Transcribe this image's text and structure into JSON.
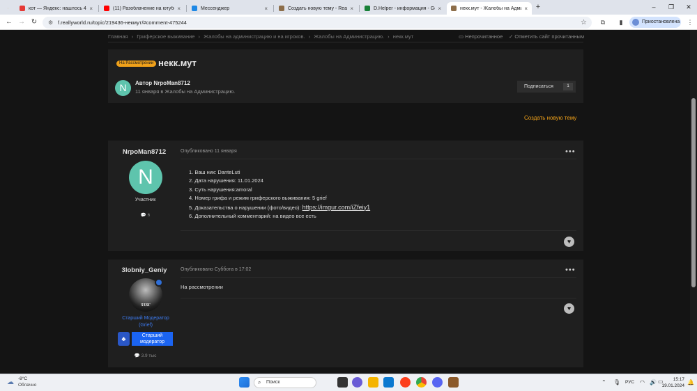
{
  "browser": {
    "tabs": [
      {
        "title": "кот — Яндекс: нашлось 4 тыс. р",
        "favicon_color": "#e53935",
        "active": false
      },
      {
        "title": "(11) Разоблачение на ютубер",
        "favicon_color": "#ff0000",
        "active": false
      },
      {
        "title": "Мессенджер",
        "favicon_color": "#1e88e5",
        "active": false
      },
      {
        "title": "Создать новую тему - ReallyW",
        "favicon_color": "#8d6e4a",
        "active": false
      },
      {
        "title": "D.Helper - информация - Goog",
        "favicon_color": "#188038",
        "active": false
      },
      {
        "title": "некк.мут - Жалобы на Админ",
        "favicon_color": "#8d6e4a",
        "active": true
      }
    ],
    "tab_close": "×",
    "new_tab": "+",
    "window_controls": {
      "minimize": "–",
      "maximize": "❐",
      "close": "✕"
    },
    "nav": {
      "back": "←",
      "forward": "→",
      "reload": "↻"
    },
    "url": "f.reallyworld.ru/topic/219436-некмут/#comment-475244",
    "profile_label": "Приостановлена"
  },
  "forum": {
    "breadcrumb": [
      "Главная",
      "›",
      "Гриферское выживание",
      "›",
      "Жалобы на администрацию и на игроков.",
      "›",
      "Жалобы на Администрацию.",
      "›",
      "некк.мут"
    ],
    "unread_label": "Непрочитанное",
    "mark_read_label": "Отметить сайт прочитанным",
    "topic": {
      "status": "На Рассмотрении",
      "title": "некк.мут",
      "author_line": "Автор NrpoMan8712",
      "meta": "11 января в Жалобы на Администрацию.",
      "avatar_letter": "N",
      "subscribe_label": "Подписаться",
      "subscribe_count": "1"
    },
    "new_topic_label": "Создать новую тему",
    "posts": [
      {
        "author": "NrpoMan8712",
        "avatar_letter": "N",
        "role": "Участник",
        "post_count": "6",
        "date": "Опубликовано 11 января",
        "menu": "•••",
        "like": "♥",
        "body": [
          "1. Ваш ник: DanteLuti",
          "2. Дата нарушения: 11.01.2024",
          "3. Суть нарушения:amoral",
          "4. Номер грифа и режим гриферского выживания: 5 grief"
        ],
        "evidence_label": "5. Доказательства о нарушении (фото/видео): ",
        "evidence_link": "https://imgur.com/iZfeiy1",
        "comment": "6. Дополнительный комментарий: на видео все есть"
      },
      {
        "author": "3lobniy_Geniy",
        "avatar_text": "ᴣᴣᴣᴦ",
        "online_badge": "●",
        "rank_line1": "Старший Модератор",
        "rank_line2": "(Grief)",
        "badge_icon": "♣",
        "badge_line1": "Старший",
        "badge_line2": "модератор",
        "post_count": "3.9 тыс",
        "date": "Опубликовано Суббота в 17:02",
        "menu": "•••",
        "like": "♥",
        "body": "На рассмотрении"
      }
    ]
  },
  "taskbar": {
    "temperature": "-8°C",
    "condition": "Облачно",
    "search_placeholder": "Поиск",
    "language": "РУС",
    "time": "15:17",
    "date": "19.01.2024"
  }
}
